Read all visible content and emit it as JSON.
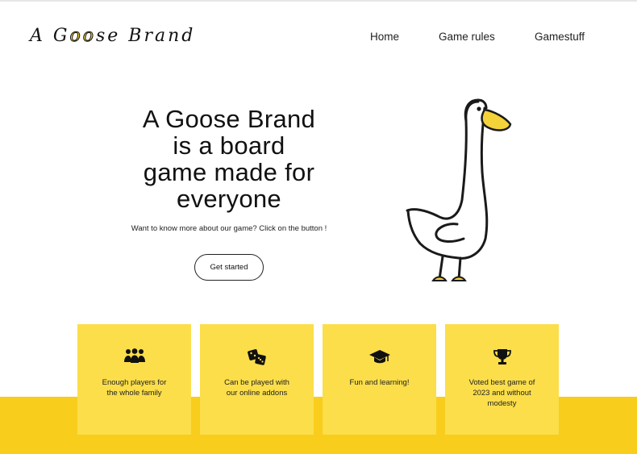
{
  "brand": {
    "logo_before": "A G",
    "logo_oo": "oo",
    "logo_after": "se Brand"
  },
  "nav": {
    "items": [
      {
        "label": "Home"
      },
      {
        "label": "Game rules"
      },
      {
        "label": "Gamestuff"
      }
    ]
  },
  "hero": {
    "title_lines": [
      "A Goose Brand",
      "is a board",
      "game made for",
      "everyone"
    ],
    "subtitle": "Want to know more about our game? Click on the button !",
    "cta_label": "Get started",
    "illustration": "goose-illustration"
  },
  "features": [
    {
      "icon": "people-group-icon",
      "lines": [
        "Enough players for",
        "the whole family"
      ]
    },
    {
      "icon": "dice-icon",
      "lines": [
        "Can be played with",
        "our online addons"
      ]
    },
    {
      "icon": "graduation-cap-icon",
      "lines": [
        "Fun and learning!"
      ]
    },
    {
      "icon": "trophy-icon",
      "lines": [
        "Voted best game of",
        "2023 and without",
        "modesty"
      ]
    }
  ],
  "colors": {
    "card_yellow": "#fbde4a",
    "band_yellow": "#f8cd1c",
    "beak_yellow": "#f4d23a",
    "text": "#111111"
  }
}
